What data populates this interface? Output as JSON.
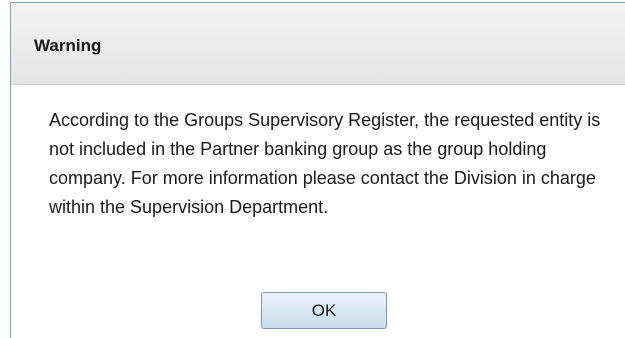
{
  "dialog": {
    "title": "Warning",
    "message": "According to the Groups Supervisory Register, the requested entity is not included in the Partner banking group as the group holding company. For more information please contact the Division in charge within the Supervision Department.",
    "ok_label": "OK"
  },
  "colors": {
    "titlebar_bg": "#e8e8e8",
    "border": "#8da2b5",
    "button_bg": "#d6e5f3",
    "button_border": "#7f97b2",
    "text": "#1a1a1a"
  }
}
